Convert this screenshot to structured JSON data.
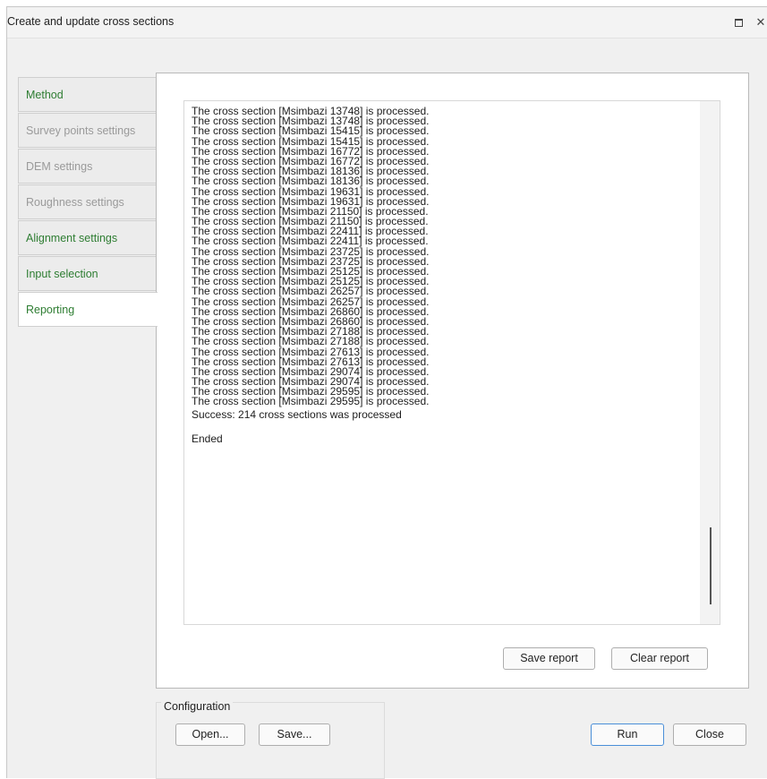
{
  "window": {
    "title": "Create and update cross sections"
  },
  "tabs": [
    {
      "label": "Method",
      "state": "enabled"
    },
    {
      "label": "Survey points settings",
      "state": "disabled"
    },
    {
      "label": "DEM settings",
      "state": "disabled"
    },
    {
      "label": "Roughness settings",
      "state": "disabled"
    },
    {
      "label": "Alignment settings",
      "state": "enabled"
    },
    {
      "label": "Input selection",
      "state": "enabled"
    },
    {
      "label": "Reporting",
      "state": "active"
    }
  ],
  "log": {
    "lines": [
      "The cross section [Msimbazi 13748] is processed.",
      "The cross section [Msimbazi 13748] is processed.",
      "The cross section [Msimbazi 15415] is processed.",
      "The cross section [Msimbazi 15415] is processed.",
      "The cross section [Msimbazi 16772] is processed.",
      "The cross section [Msimbazi 16772] is processed.",
      "The cross section [Msimbazi 18136] is processed.",
      "The cross section [Msimbazi 18136] is processed.",
      "The cross section [Msimbazi 19631] is processed.",
      "The cross section [Msimbazi 19631] is processed.",
      "The cross section [Msimbazi 21150] is processed.",
      "The cross section [Msimbazi 21150] is processed.",
      "The cross section [Msimbazi 22411] is processed.",
      "The cross section [Msimbazi 22411] is processed.",
      "The cross section [Msimbazi 23725] is processed.",
      "The cross section [Msimbazi 23725] is processed.",
      "The cross section [Msimbazi 25125] is processed.",
      "The cross section [Msimbazi 25125] is processed.",
      "The cross section [Msimbazi 26257] is processed.",
      "The cross section [Msimbazi 26257] is processed.",
      "The cross section [Msimbazi 26860] is processed.",
      "The cross section [Msimbazi 26860] is processed.",
      "The cross section [Msimbazi 27188] is processed.",
      "The cross section [Msimbazi 27188] is processed.",
      "The cross section [Msimbazi 27613] is processed.",
      "The cross section [Msimbazi 27613] is processed.",
      "The cross section [Msimbazi 29074] is processed.",
      "The cross section [Msimbazi 29074] is processed.",
      "The cross section [Msimbazi 29595] is processed.",
      "The cross section [Msimbazi 29595] is processed.",
      "Success: 214 cross sections was processed",
      "",
      "Ended"
    ]
  },
  "report_buttons": {
    "save": "Save report",
    "clear": "Clear report"
  },
  "configuration": {
    "label": "Configuration",
    "open": "Open...",
    "save": "Save..."
  },
  "actions": {
    "run": "Run",
    "close": "Close"
  },
  "colors": {
    "tab_green": "#2e7d32",
    "tab_disabled": "#9a9a9a",
    "primary_border": "#4a8fd8"
  }
}
